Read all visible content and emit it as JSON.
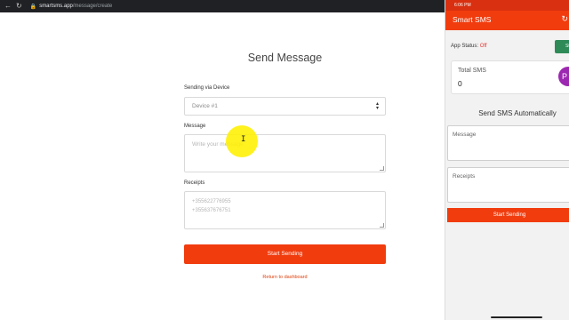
{
  "browser": {
    "back_glyph": "←",
    "reload_glyph": "↻",
    "url_host": "smartsms.app",
    "url_path": "/message/create"
  },
  "page": {
    "title": "Send Message",
    "device_label": "Sending via Device",
    "device_value": "Device #1",
    "message_label": "Message",
    "message_placeholder": "Write your message",
    "receipts_label": "Receipts",
    "receipts_placeholder_line1": "+355622776955",
    "receipts_placeholder_line2": "+355637676751",
    "start_button": "Start Sending",
    "return_link": "Return to dashboard"
  },
  "phone": {
    "status_time": "6:06 PM",
    "app_title": "Smart SMS",
    "app_status_label": "App Status:",
    "app_status_value": "Off",
    "toggle_label": "St",
    "total_sms_label": "Total SMS",
    "total_sms_value": "0",
    "auto_heading": "Send SMS Automatically",
    "message_placeholder": "Message",
    "receipts_placeholder": "Receipts",
    "start_button": "Start Sending",
    "fab_glyph": "P"
  },
  "colors": {
    "accent": "#f13c0e",
    "status_off": "#e53935",
    "toggle_green": "#2e8b57",
    "fab_purple": "#9c27b0",
    "cursor_highlight": "#fff000"
  },
  "icons": [
    "back-icon",
    "reload-icon",
    "lock-icon",
    "select-caret-icon",
    "refresh-icon",
    "text-cursor-icon"
  ]
}
